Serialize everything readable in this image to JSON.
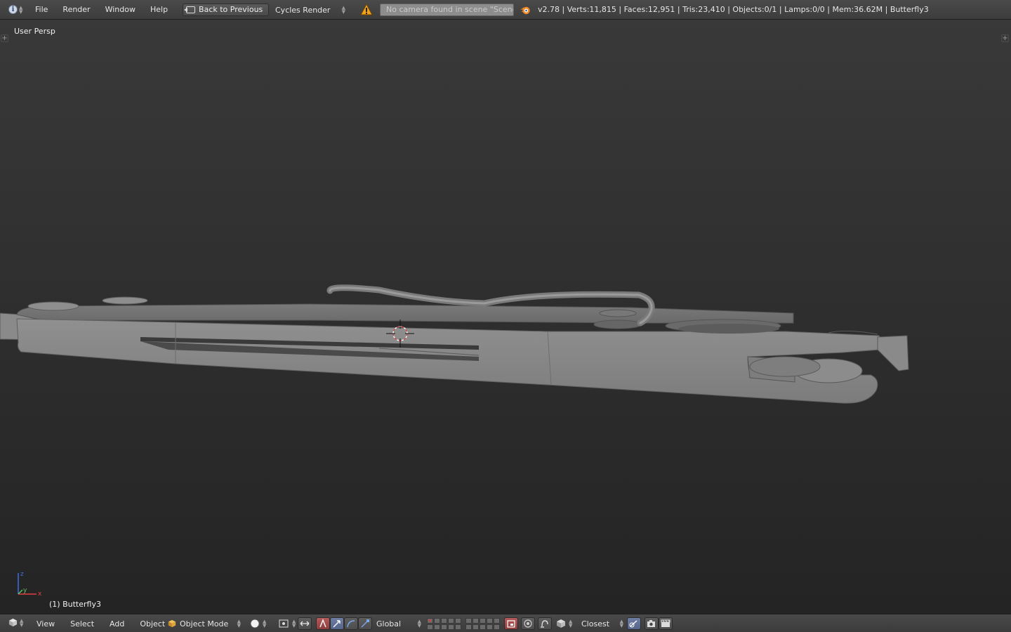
{
  "top_header": {
    "menus": [
      "File",
      "Render",
      "Window",
      "Help"
    ],
    "back_button_label": "Back to Previous",
    "render_engine": "Cycles Render",
    "warning_message": "No camera found in scene \"Scene\"",
    "stats": "v2.78 | Verts:11,815 | Faces:12,951 | Tris:23,410 | Objects:0/1 | Lamps:0/0 | Mem:36.62M | Butterfly3"
  },
  "viewport": {
    "view_name": "User Persp",
    "object_label": "(1) Butterfly3",
    "axes": {
      "x": "x",
      "y": "y",
      "z": "z"
    },
    "colors": {
      "model": "#8a8a8a",
      "model_dark": "#5e5e5e",
      "bg_top": "#393939",
      "bg_bottom": "#242424"
    }
  },
  "bottom_header": {
    "menus": [
      "View",
      "Select",
      "Add",
      "Object"
    ],
    "mode": "Object Mode",
    "orientation": "Global",
    "snap_target": "Closest",
    "icons": [
      "cube-icon",
      "solid-shading-icon",
      "pivot-icon",
      "manipulator-toggle-icon",
      "translate-icon",
      "rotate-icon",
      "scale-icon",
      "layer-grid",
      "lock-layers-icon",
      "proportional-edit-icon",
      "snap-icon",
      "snap-element-icon",
      "render-camera-icon",
      "render-animation-icon"
    ]
  }
}
